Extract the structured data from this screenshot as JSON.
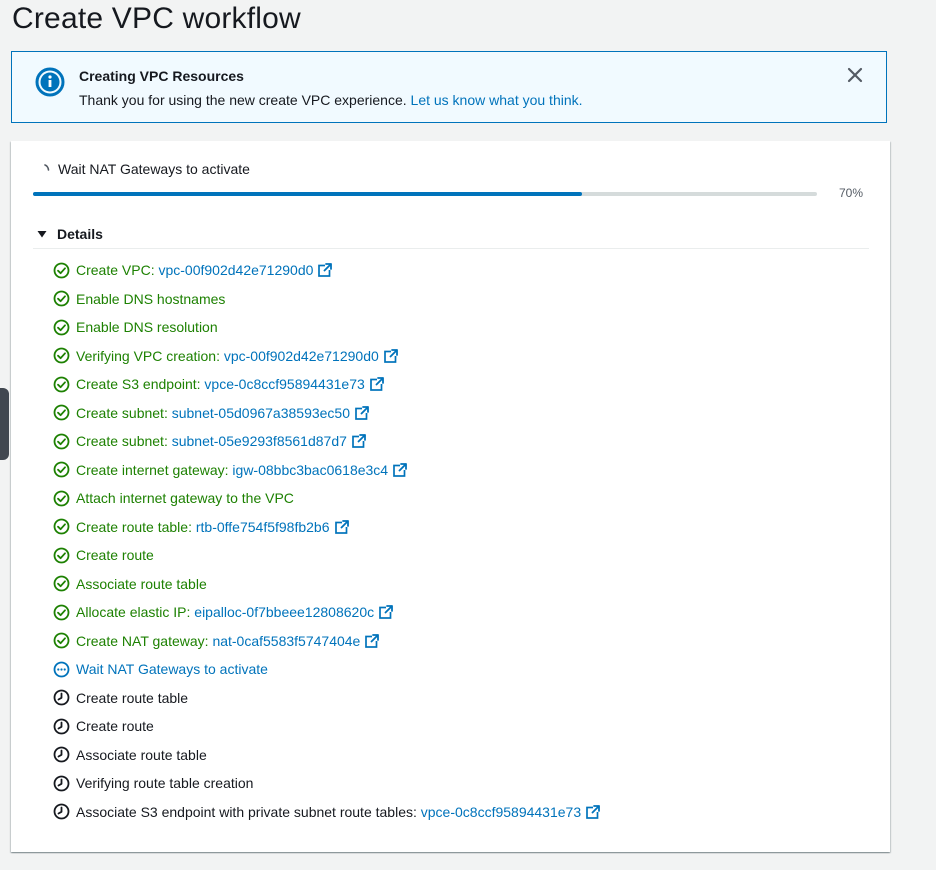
{
  "page": {
    "title": "Create VPC workflow"
  },
  "alert": {
    "title": "Creating VPC Resources",
    "body": "Thank you for using the new create VPC experience.",
    "link": "Let us know what you think.",
    "icon": "info-icon"
  },
  "status": {
    "label": "Wait NAT Gateways to activate",
    "progress_percent": 70,
    "progress_text": "70%"
  },
  "details": {
    "label": "Details"
  },
  "colors": {
    "success": "#1d8102",
    "in_progress": "#0073bb",
    "pending": "#16191f",
    "link": "#0073bb"
  },
  "steps": [
    {
      "text": "Create VPC:",
      "resource": "vpc-00f902d42e71290d0",
      "status": "done"
    },
    {
      "text": "Enable DNS hostnames",
      "resource": "",
      "status": "done"
    },
    {
      "text": "Enable DNS resolution",
      "resource": "",
      "status": "done"
    },
    {
      "text": "Verifying VPC creation:",
      "resource": "vpc-00f902d42e71290d0",
      "status": "done"
    },
    {
      "text": "Create S3 endpoint:",
      "resource": "vpce-0c8ccf95894431e73",
      "status": "done"
    },
    {
      "text": "Create subnet:",
      "resource": "subnet-05d0967a38593ec50",
      "status": "done"
    },
    {
      "text": "Create subnet:",
      "resource": "subnet-05e9293f8561d87d7",
      "status": "done"
    },
    {
      "text": "Create internet gateway:",
      "resource": "igw-08bbc3bac0618e3c4",
      "status": "done"
    },
    {
      "text": "Attach internet gateway to the VPC",
      "resource": "",
      "status": "done"
    },
    {
      "text": "Create route table:",
      "resource": "rtb-0ffe754f5f98fb2b6",
      "status": "done"
    },
    {
      "text": "Create route",
      "resource": "",
      "status": "done"
    },
    {
      "text": "Associate route table",
      "resource": "",
      "status": "done"
    },
    {
      "text": "Allocate elastic IP:",
      "resource": "eipalloc-0f7bbeee12808620c",
      "status": "done"
    },
    {
      "text": "Create NAT gateway:",
      "resource": "nat-0caf5583f5747404e",
      "status": "done"
    },
    {
      "text": "Wait NAT Gateways to activate",
      "resource": "",
      "status": "progress"
    },
    {
      "text": "Create route table",
      "resource": "",
      "status": "pending"
    },
    {
      "text": "Create route",
      "resource": "",
      "status": "pending"
    },
    {
      "text": "Associate route table",
      "resource": "",
      "status": "pending"
    },
    {
      "text": "Verifying route table creation",
      "resource": "",
      "status": "pending"
    },
    {
      "text": "Associate S3 endpoint with private subnet route tables:",
      "resource": "vpce-0c8ccf95894431e73",
      "status": "pending"
    }
  ]
}
